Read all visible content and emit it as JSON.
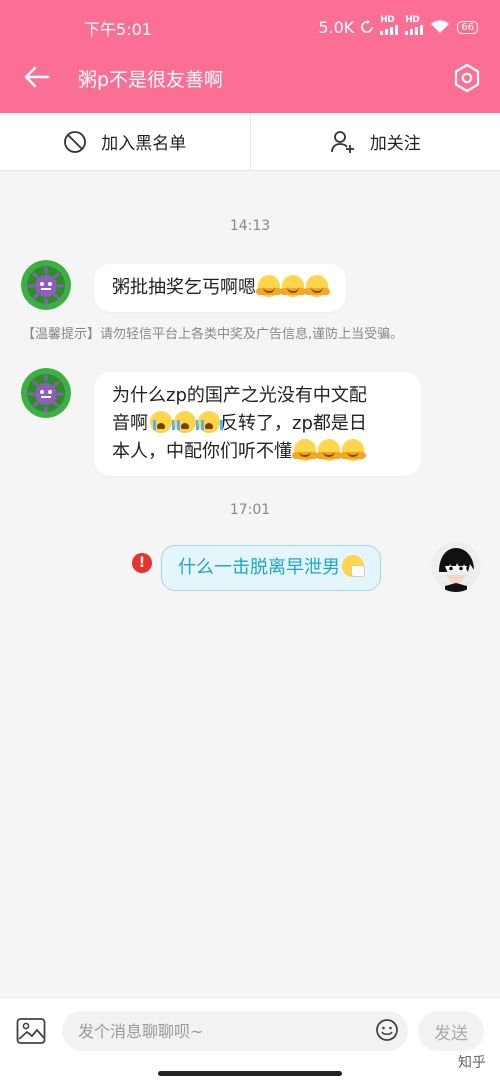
{
  "status_bar": {
    "time": "下午5:01",
    "speed": "5.0K",
    "signal1": "HD",
    "signal2": "HD",
    "battery": "66"
  },
  "header": {
    "title": "粥p不是很友善啊",
    "back_icon": "arrow-left-icon",
    "settings_icon": "settings-hexagon-icon",
    "color": "#fc6f95"
  },
  "actions": {
    "block_label": "加入黑名单",
    "follow_label": "加关注"
  },
  "chat": {
    "timestamp1": "14:13",
    "msg1": "粥批抽奖乞丐啊嗯",
    "tip": "【温馨提示】请勿轻信平台上各类中奖及广告信息,谨防上当受骗。",
    "msg2_line1": "为什么zp的国产之光没有中文配",
    "msg2_line2_a": "音啊",
    "msg2_line2_b": "反转了，zp都是日",
    "msg2_line3": "本人，中配你们听不懂",
    "timestamp2": "17:01",
    "msg3": "什么一击脱离早泄男",
    "error_mark": "!"
  },
  "input": {
    "placeholder": "发个消息聊聊呗~",
    "send_label": "发送"
  },
  "watermark": "知乎"
}
